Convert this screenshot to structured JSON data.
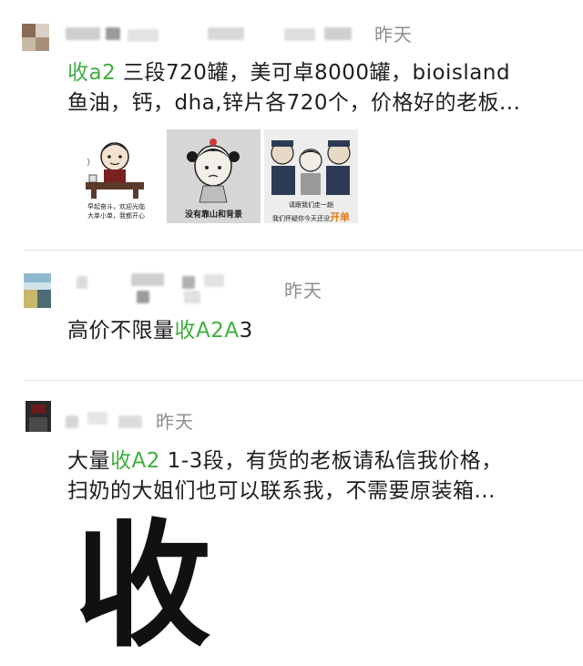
{
  "posts": [
    {
      "timestamp": "昨天",
      "keyword": "收a2",
      "text_line1_rest": " 三段720罐，美可卓8000罐，bioisland",
      "text_line2": "鱼油，钙，dha,锌片各720个，价格好的老板...",
      "images": [
        {
          "caption_line1": "早起奋斗，欢迎光临",
          "caption_line2": "大单小单，我都开心"
        },
        {
          "caption": "没有靠山和背景"
        },
        {
          "caption_line1": "请跟我们走一趟",
          "caption_line2": "我们怀疑你今天还没",
          "caption_accent": "开单"
        }
      ]
    },
    {
      "timestamp": "昨天",
      "text_before": "高价不限量",
      "keyword": "收A2A",
      "text_after": "3"
    },
    {
      "timestamp": "昨天",
      "text_before": "大量",
      "keyword": "收A2",
      "text_line1_rest": " 1-3段，有货的老板请私信我价格，",
      "text_line2": "扫奶的大姐们也可以联系我，不需要原装箱...",
      "big_char": "收"
    }
  ],
  "colors": {
    "keyword_green": "#3fae3f",
    "timestamp_gray": "#8e8e8e",
    "divider": "#e6e6e6",
    "accent_orange": "#e07b1a"
  }
}
